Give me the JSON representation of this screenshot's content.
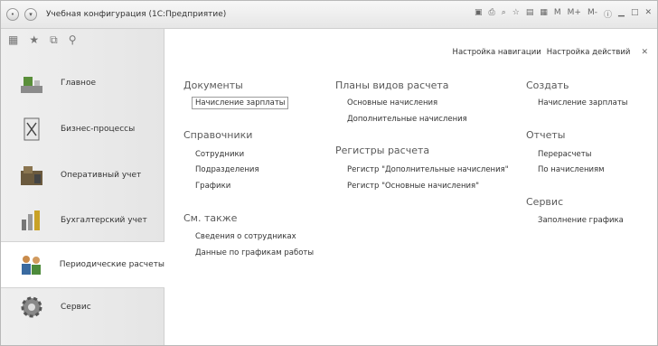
{
  "window": {
    "title": "Учебная конфигурация (1С:Предприятие)",
    "toolbar_icons": [
      "save-icon",
      "print-icon",
      "preview-icon",
      "favorite-icon",
      "calendar-icon",
      "calculator-icon",
      "memory-m",
      "memory-m-plus",
      "memory-m-minus",
      "info-icon",
      "minimize-icon",
      "maximize-icon",
      "close-icon"
    ],
    "memory_labels": [
      "M",
      "M+",
      "M-"
    ]
  },
  "sidebar": {
    "items": [
      {
        "label": "Главное",
        "icon": "desk-icon"
      },
      {
        "label": "Бизнес-процессы",
        "icon": "process-icon"
      },
      {
        "label": "Оперативный учет",
        "icon": "warehouse-icon"
      },
      {
        "label": "Бухгалтерский учет",
        "icon": "accounting-icon"
      },
      {
        "label": "Периодические расчеты",
        "icon": "people-icon"
      },
      {
        "label": "Сервис",
        "icon": "gear-icon"
      }
    ]
  },
  "main": {
    "top_links": [
      "Настройка навигации",
      "Настройка действий"
    ],
    "columns": [
      {
        "sections": [
          {
            "title": "Документы",
            "links": [
              "Начисление зарплаты"
            ]
          },
          {
            "title": "Справочники",
            "links": [
              "Сотрудники",
              "Подразделения",
              "Графики"
            ]
          },
          {
            "title": "См. также",
            "links": [
              "Сведения о сотрудниках",
              "Данные по графикам работы"
            ]
          }
        ]
      },
      {
        "sections": [
          {
            "title": "Планы видов расчета",
            "links": [
              "Основные начисления",
              "Дополнительные начисления"
            ]
          },
          {
            "title": "Регистры расчета",
            "links": [
              "Регистр \"Дополнительные начисления\"",
              "Регистр \"Основные начисления\""
            ]
          }
        ]
      },
      {
        "sections": [
          {
            "title": "Создать",
            "links": [
              "Начисление зарплаты"
            ]
          },
          {
            "title": "Отчеты",
            "links": [
              "Перерасчеты",
              "По начислениям"
            ]
          },
          {
            "title": "Сервис",
            "links": [
              "Заполнение графика"
            ]
          }
        ]
      }
    ]
  }
}
